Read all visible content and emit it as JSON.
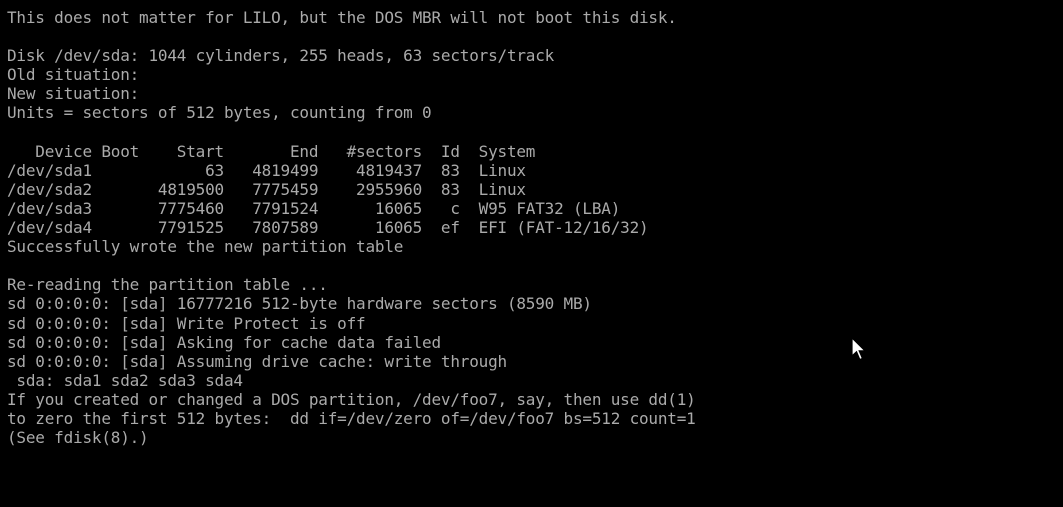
{
  "console": {
    "lines": [
      "This does not matter for LILO, but the DOS MBR will not boot this disk.",
      "",
      "Disk /dev/sda: 1044 cylinders, 255 heads, 63 sectors/track",
      "Old situation:",
      "New situation:",
      "Units = sectors of 512 bytes, counting from 0",
      "",
      "   Device Boot    Start       End   #sectors  Id  System",
      "/dev/sda1            63   4819499    4819437  83  Linux",
      "/dev/sda2       4819500   7775459    2955960  83  Linux",
      "/dev/sda3       7775460   7791524      16065   c  W95 FAT32 (LBA)",
      "/dev/sda4       7791525   7807589      16065  ef  EFI (FAT-12/16/32)",
      "Successfully wrote the new partition table",
      "",
      "Re-reading the partition table ...",
      "sd 0:0:0:0: [sda] 16777216 512-byte hardware sectors (8590 MB)",
      "sd 0:0:0:0: [sda] Write Protect is off",
      "sd 0:0:0:0: [sda] Asking for cache data failed",
      "sd 0:0:0:0: [sda] Assuming drive cache: write through",
      " sda: sda1 sda2 sda3 sda4",
      "If you created or changed a DOS partition, /dev/foo7, say, then use dd(1)",
      "to zero the first 512 bytes:  dd if=/dev/zero of=/dev/foo7 bs=512 count=1",
      "(See fdisk(8).)"
    ]
  },
  "colors": {
    "background": "#000000",
    "text": "#aaaaaa",
    "pointer_fill": "#ffffff",
    "pointer_outline": "#000000"
  },
  "pointer": {
    "icon": "mouse-pointer-arrow-icon"
  }
}
